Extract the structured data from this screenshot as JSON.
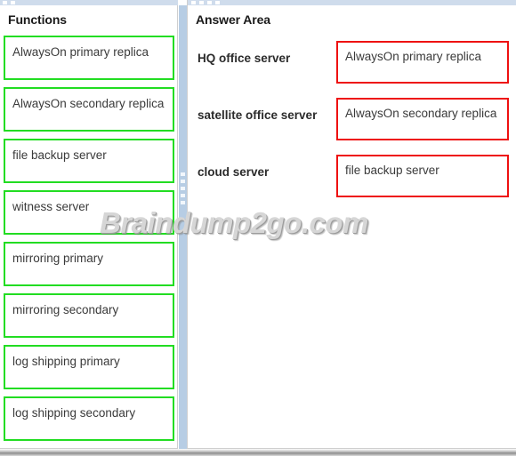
{
  "window": {
    "bottom_edge": "",
    "splitter_name": "panel-splitter"
  },
  "left_panel": {
    "heading": "Functions",
    "items": [
      {
        "label": "AlwaysOn primary replica"
      },
      {
        "label": "AlwaysOn secondary replica"
      },
      {
        "label": "file backup server"
      },
      {
        "label": "witness server"
      },
      {
        "label": "mirroring primary"
      },
      {
        "label": "mirroring secondary"
      },
      {
        "label": "log shipping primary"
      },
      {
        "label": "log shipping secondary"
      }
    ],
    "item_border_color": "#22dd22"
  },
  "right_panel": {
    "heading": "Answer Area",
    "rows": [
      {
        "label": "HQ office server",
        "answer": "AlwaysOn primary replica"
      },
      {
        "label": "satellite office server",
        "answer": "AlwaysOn secondary replica"
      },
      {
        "label": "cloud server",
        "answer": "file backup server"
      }
    ],
    "answer_border_color": "#ee1111"
  },
  "watermark": {
    "text": "Braindump2go.com"
  },
  "colors": {
    "accent_band": "#cfdcec",
    "splitter": "#b7cde4",
    "green": "#22dd22",
    "red": "#ee1111"
  }
}
